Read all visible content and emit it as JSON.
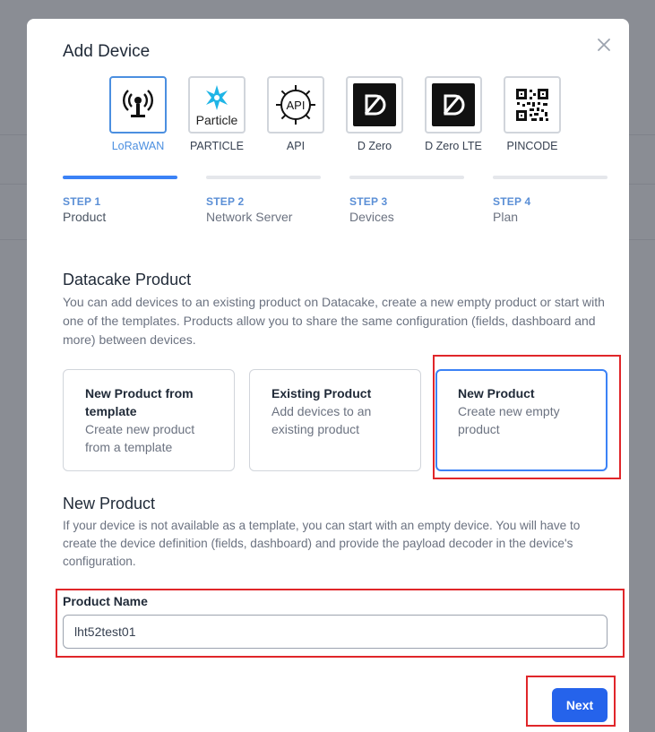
{
  "modal": {
    "title": "Add Device"
  },
  "device_types": [
    {
      "label": "LoRaWAN",
      "icon": "lorawan-antenna-icon",
      "selected": true
    },
    {
      "label": "PARTICLE",
      "icon": "particle-logo-icon",
      "logo_text": "Particle",
      "selected": false
    },
    {
      "label": "API",
      "icon": "api-gear-icon",
      "logo_text": "API",
      "selected": false
    },
    {
      "label": "D Zero",
      "icon": "dzero-logo-icon",
      "selected": false
    },
    {
      "label": "D Zero LTE",
      "icon": "dzero-lte-logo-icon",
      "selected": false
    },
    {
      "label": "PINCODE",
      "icon": "qr-code-icon",
      "selected": false
    }
  ],
  "steps": [
    {
      "number": "STEP 1",
      "name": "Product",
      "active": true
    },
    {
      "number": "STEP 2",
      "name": "Network Server",
      "active": false
    },
    {
      "number": "STEP 3",
      "name": "Devices",
      "active": false
    },
    {
      "number": "STEP 4",
      "name": "Plan",
      "active": false
    }
  ],
  "datacake_product": {
    "title": "Datacake Product",
    "description": "You can add devices to an existing product on Datacake, create a new empty product or start with one of the templates. Products allow you to share the same configuration (fields, dashboard and more) between devices."
  },
  "product_options": [
    {
      "title": "New Product from template",
      "description": "Create new product from a template",
      "selected": false
    },
    {
      "title": "Existing Product",
      "description": "Add devices to an existing product",
      "selected": false
    },
    {
      "title": "New Product",
      "description": "Create new empty product",
      "selected": true
    }
  ],
  "new_product": {
    "title": "New Product",
    "description": "If your device is not available as a template, you can start with an empty device. You will have to create the device definition (fields, dashboard) and provide the payload decoder in the device's configuration.",
    "product_name_label": "Product Name",
    "product_name_value": "lht52test01"
  },
  "actions": {
    "next_label": "Next"
  },
  "colors": {
    "accent": "#3b82f6",
    "primary_button": "#2563eb",
    "annotation": "#e0262a"
  }
}
